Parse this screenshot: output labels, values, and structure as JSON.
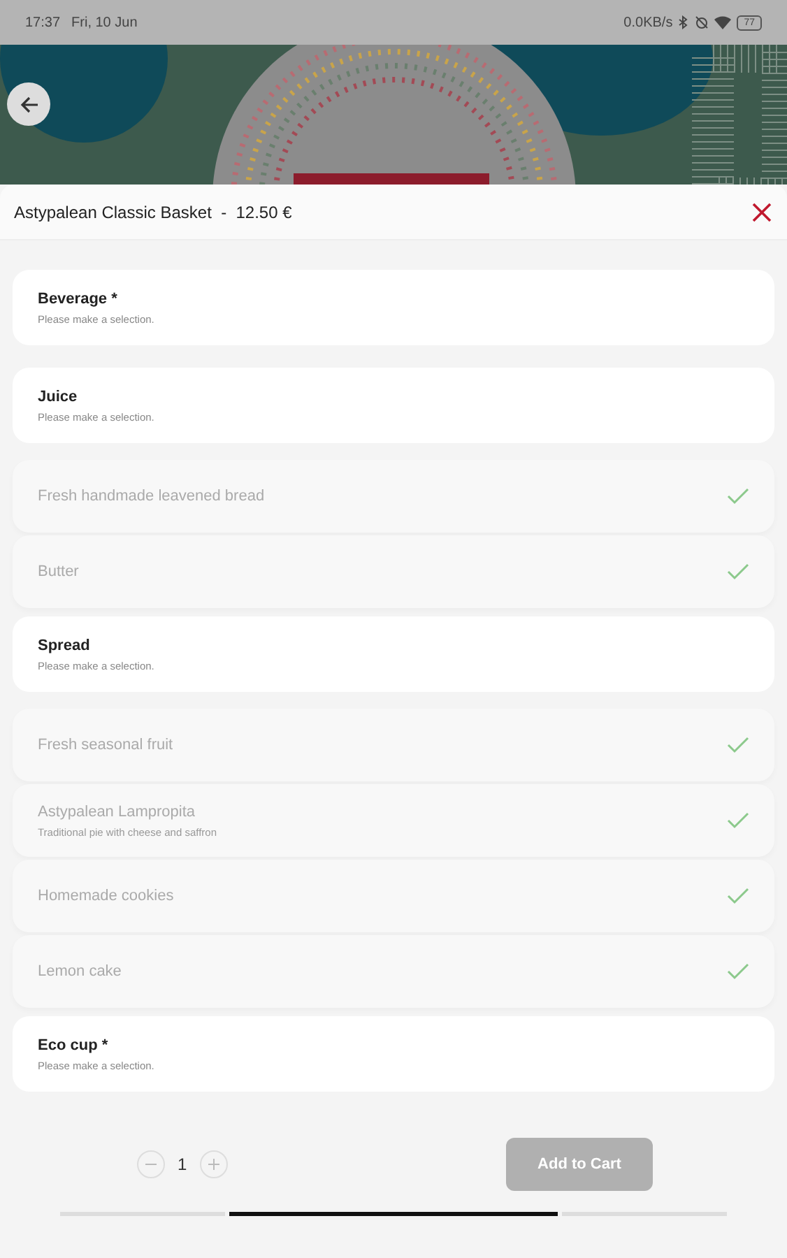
{
  "status_bar": {
    "time": "17:37",
    "date": "Fri, 10 Jun",
    "speed": "0.0KB/s",
    "battery": "77"
  },
  "sheet": {
    "title": "Astypalean Classic Basket",
    "separator": "-",
    "price": "12.50 €"
  },
  "items": [
    {
      "kind": "choice",
      "name": "Beverage *",
      "note": "Please make a selection."
    },
    {
      "kind": "choice",
      "name": "Juice",
      "note": "Please make a selection."
    },
    {
      "kind": "included",
      "name": "Fresh handmade leavened bread"
    },
    {
      "kind": "included",
      "name": "Butter"
    },
    {
      "kind": "choice",
      "name": "Spread",
      "note": "Please make a selection."
    },
    {
      "kind": "included",
      "name": "Fresh seasonal fruit"
    },
    {
      "kind": "included",
      "name": "Astypalean Lampropita",
      "note": "Traditional pie with cheese and saffron"
    },
    {
      "kind": "included",
      "name": "Homemade cookies"
    },
    {
      "kind": "included",
      "name": "Lemon cake"
    },
    {
      "kind": "choice",
      "name": "Eco cup *",
      "note": "Please make a selection."
    }
  ],
  "footer": {
    "quantity": "1",
    "add_button": {
      "label": "Add to Cart",
      "disabled": true
    }
  }
}
